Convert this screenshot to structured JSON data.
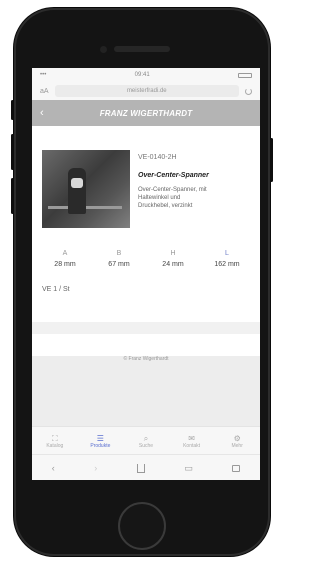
{
  "status_bar": {
    "time": "09:41"
  },
  "browser": {
    "url": "meisterfradi.de",
    "text_size_label": "aA"
  },
  "nav": {
    "title": "FRANZ WIGERTHARDT",
    "back_glyph": "‹"
  },
  "product": {
    "part_number": "VE-0140-2H",
    "title": "Over-Center-Spanner",
    "description": "Over-Center-Spanner, mit\nHaltewinkel und\nDruckhebel, verzinkt",
    "specs": [
      {
        "key": "A",
        "value": "28 mm"
      },
      {
        "key": "B",
        "value": "67 mm"
      },
      {
        "key": "H",
        "value": "24 mm"
      },
      {
        "key": "L",
        "value": "162 mm"
      }
    ],
    "note": "VE 1 / St"
  },
  "footer": {
    "text": "© Franz Wigerthardt"
  },
  "tabs": [
    {
      "icon": "⛶",
      "label": "Katalog"
    },
    {
      "icon": "☰",
      "label": "Produkte"
    },
    {
      "icon": "⌕",
      "label": "Suche"
    },
    {
      "icon": "✉",
      "label": "Kontakt"
    },
    {
      "icon": "⚙",
      "label": "Mehr"
    }
  ],
  "accent_color": "#5a6fd0"
}
